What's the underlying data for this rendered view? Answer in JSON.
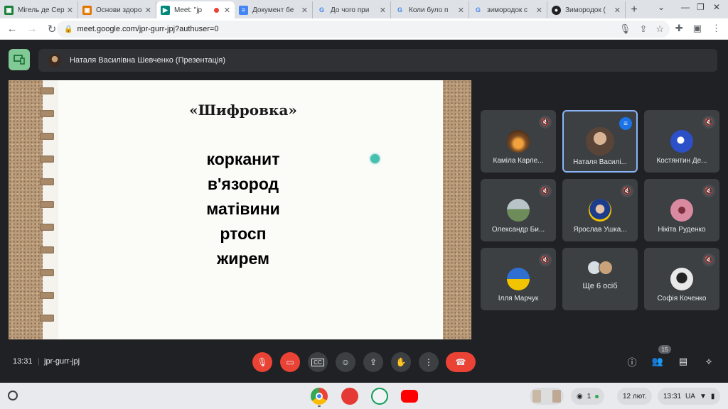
{
  "browser": {
    "tabs": [
      {
        "title": "Мігель де Сер",
        "favicon": "classroom-icon",
        "color": "#188038",
        "active": false
      },
      {
        "title": "Основи здоро",
        "favicon": "classroom-icon",
        "color": "#e37400",
        "active": false
      },
      {
        "title": "Meet: \"jp",
        "favicon": "meet-icon",
        "color": "#00897b",
        "active": true,
        "recording": true
      },
      {
        "title": "Документ бе",
        "favicon": "docs-icon",
        "color": "#4285f4",
        "active": false
      },
      {
        "title": "До чого при",
        "favicon": "google-icon",
        "color": "#4285f4",
        "active": false
      },
      {
        "title": "Коли було п",
        "favicon": "google-icon",
        "color": "#4285f4",
        "active": false
      },
      {
        "title": "зимородок с",
        "favicon": "google-icon",
        "color": "#4285f4",
        "active": false
      },
      {
        "title": "Зимородок (",
        "favicon": "user-icon",
        "color": "#202124",
        "active": false
      }
    ],
    "url": "meet.google.com/jpr-gurr-jpj?authuser=0"
  },
  "meet": {
    "presenter_label": "Наталя Василівна Шевченко (Презентація)",
    "slide": {
      "title": "«Шифровка»",
      "words": [
        "корканит",
        "в'язород",
        "матівини",
        "ртосп",
        "жирем"
      ]
    },
    "participants": [
      {
        "name": "Каміла Карле...",
        "muted": true,
        "avatar": "#7a4b23"
      },
      {
        "name": "Наталя Василі...",
        "muted": false,
        "speaking": true,
        "avatar": "#5a4438"
      },
      {
        "name": "Костянтин Де...",
        "muted": true,
        "avatar": "#2b50c8"
      },
      {
        "name": "Олександр Би...",
        "muted": true,
        "avatar": "#6e8c5a"
      },
      {
        "name": "Ярослав Ушка...",
        "muted": true,
        "avatar": "#1c3c8c"
      },
      {
        "name": "Нікіта Руденко",
        "muted": true,
        "avatar": "#d98aa0"
      },
      {
        "name": "Ілля Марчук",
        "muted": true,
        "avatar": "#2f6fd1"
      },
      {
        "more_label": "Ще 6 осіб"
      },
      {
        "name": "Софія Коченко",
        "muted": true,
        "avatar": "#e8e8e8"
      }
    ],
    "time": "13:31",
    "meeting_code": "jpr-gurr-jpj",
    "participant_count": "15"
  },
  "shelf": {
    "date": "12 лют.",
    "time": "13:31",
    "lang": "UA",
    "notification_count": "1"
  }
}
